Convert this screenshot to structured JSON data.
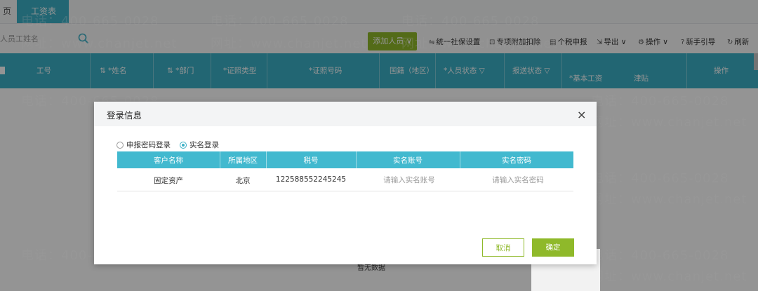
{
  "tabs": {
    "home_label": "页",
    "active_label": "工资表",
    "close_glyph": "×"
  },
  "toolbar": {
    "search_placeholder": "人员工姓名",
    "add_label": "添加人员 ∨",
    "items": [
      {
        "icon": "⇋",
        "label": "统一社保设置"
      },
      {
        "icon": "⊡",
        "label": "专项附加扣除"
      },
      {
        "icon": "▤",
        "label": "个税申报"
      },
      {
        "icon": "⇲",
        "label": "导出 ∨"
      },
      {
        "icon": "⚙",
        "label": "操作 ∨"
      },
      {
        "icon": "?",
        "label": "新手引导"
      },
      {
        "icon": "↻",
        "label": "刷新"
      }
    ]
  },
  "table_header": {
    "cols": [
      "工号",
      "*姓名",
      "*部门",
      "*证照类型",
      "*证照号码",
      "国籍（地区）",
      "*人员状态",
      "报送状态",
      "*基本工资",
      "津贴",
      "操作"
    ]
  },
  "empty_text": "暂无数据",
  "watermark": {
    "phone": "电话：400-665-0028",
    "site": "网址：www.chanjet.net"
  },
  "dialog": {
    "title": "登录信息",
    "close_glyph": "×",
    "radios": [
      {
        "label": "申报密码登录",
        "checked": false
      },
      {
        "label": "实名登录",
        "checked": true
      }
    ],
    "table": {
      "headers": [
        "客户名称",
        "所属地区",
        "税号",
        "实名账号",
        "实名密码"
      ],
      "row": {
        "customer": "固定资产",
        "region": "北京",
        "tax_no": "122588552245245",
        "account_placeholder": "请输入实名账号",
        "password_placeholder": "请输入实名密码"
      }
    },
    "cancel_label": "取消",
    "ok_label": "确定"
  },
  "colors": {
    "teal": "#3bb0c6",
    "green": "#8fb92a"
  }
}
